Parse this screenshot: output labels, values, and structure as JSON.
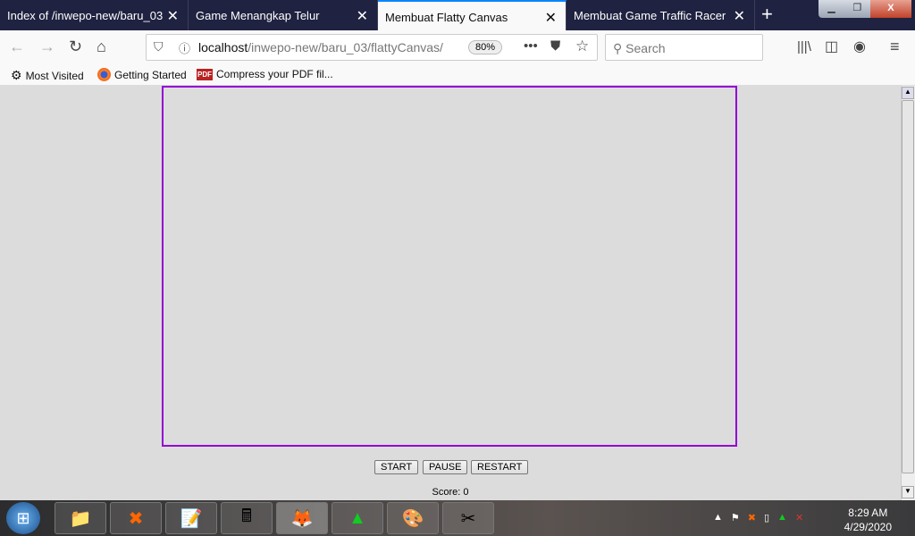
{
  "browser": {
    "tabs": [
      {
        "label": "Index of /inwepo-new/baru_03"
      },
      {
        "label": "Game Menangkap Telur"
      },
      {
        "label": "Membuat Flatty Canvas",
        "active": true
      },
      {
        "label": "Membuat Game Traffic Racer"
      }
    ],
    "url_host": "localhost",
    "url_path": "/inwepo-new/baru_03/flattyCanvas/",
    "zoom": "80%",
    "search_placeholder": "Search",
    "bookmarks": [
      {
        "label": "Most Visited",
        "icon": "gear-icon"
      },
      {
        "label": "Getting Started",
        "icon": "firefox-icon"
      },
      {
        "label": "Compress your PDF fil...",
        "icon": "pdf-icon"
      }
    ],
    "pdf_badge": "PDF"
  },
  "page": {
    "canvas_border_color": "#9400d3",
    "buttons": {
      "start": "START",
      "pause": "PAUSE",
      "restart": "RESTART"
    },
    "score": "Score: 0"
  },
  "taskbar": {
    "time": "8:29 AM",
    "date": "4/29/2020"
  }
}
